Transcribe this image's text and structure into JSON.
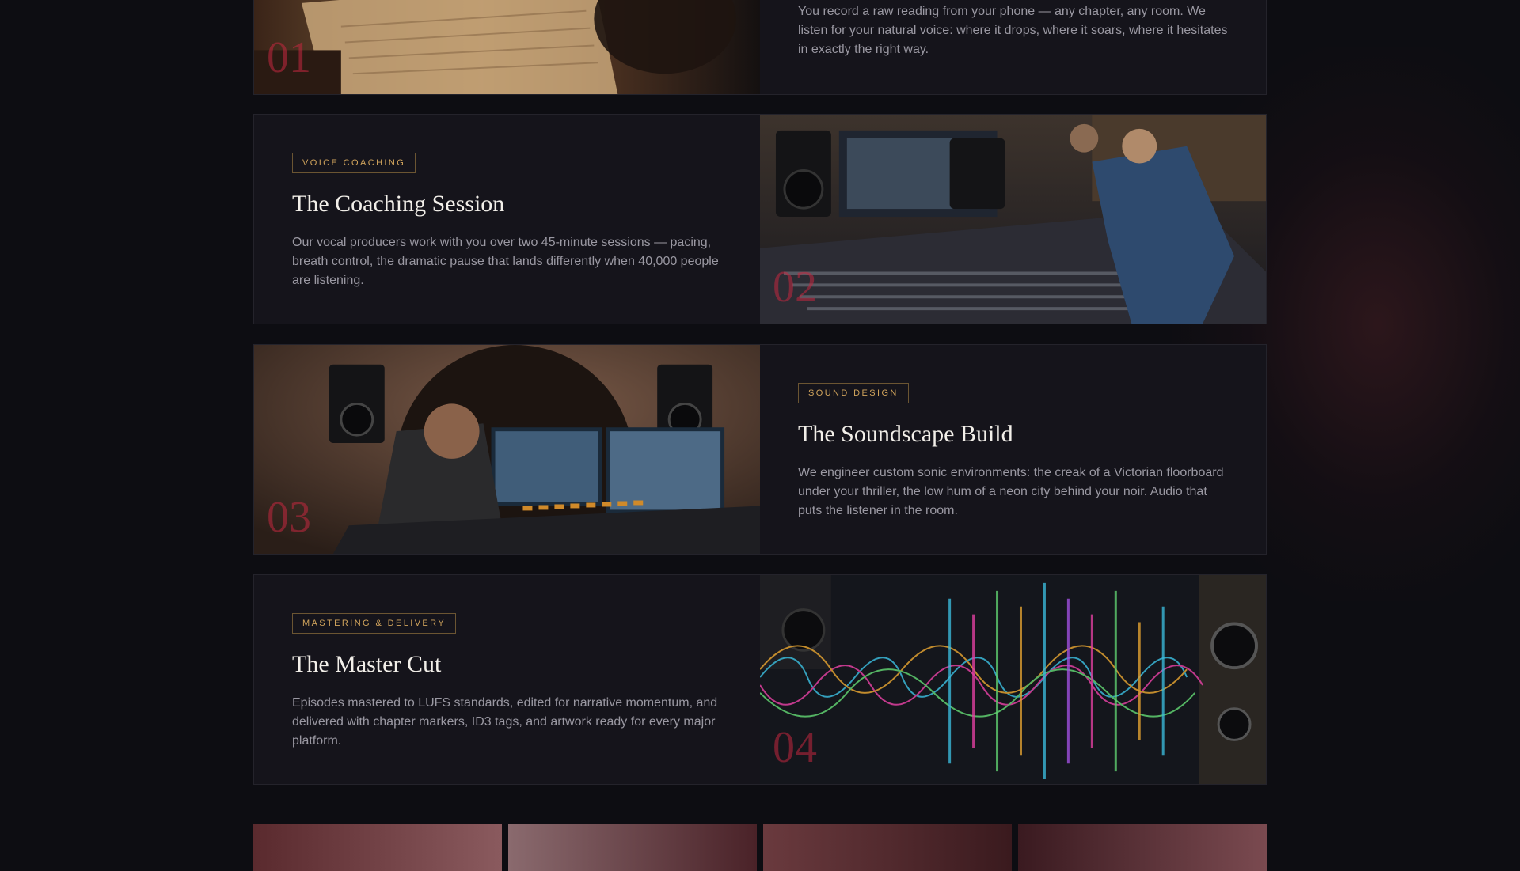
{
  "steps": [
    {
      "number": "01",
      "tag": "",
      "title": "",
      "desc": "You record a raw reading from your phone — any chapter, any room. We listen for your natural voice: where it drops, where it soars, where it hesitates in exactly the right way."
    },
    {
      "number": "02",
      "tag": "VOICE COACHING",
      "title": "The Coaching Session",
      "desc": "Our vocal producers work with you over two 45-minute sessions — pacing, breath control, the dramatic pause that lands differently when 40,000 people are listening."
    },
    {
      "number": "03",
      "tag": "SOUND DESIGN",
      "title": "The Soundscape Build",
      "desc": "We engineer custom sonic environments: the creak of a Victorian floorboard under your thriller, the low hum of a neon city behind your noir. Audio that puts the listener in the room."
    },
    {
      "number": "04",
      "tag": "MASTERING & DELIVERY",
      "title": "The Master Cut",
      "desc": "Episodes mastered to LUFS standards, edited for narrative momentum, and delivered with chapter markers, ID3 tags, and artwork ready for every major platform."
    }
  ],
  "colors": {
    "background": "#0d0d12",
    "card": "#15141b",
    "accent_tag": "#d1a45c",
    "accent_number": "#c42840"
  }
}
